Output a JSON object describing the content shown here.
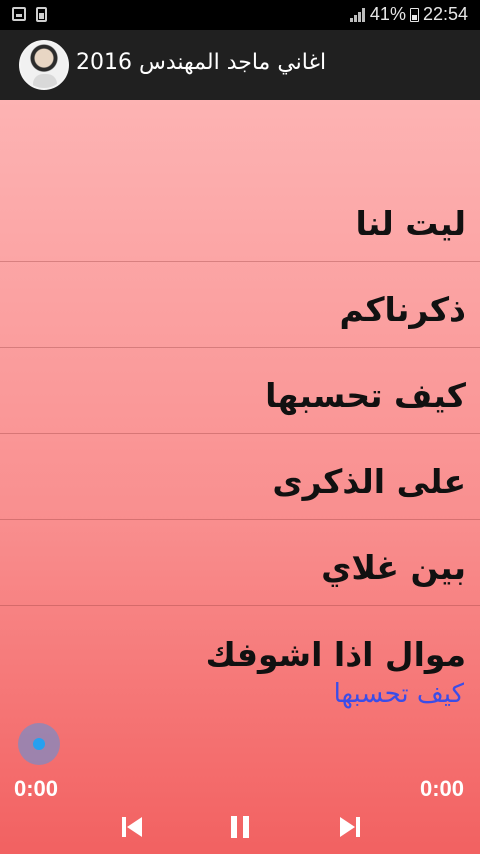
{
  "status_bar": {
    "battery_percent": "41%",
    "time": "22:54"
  },
  "app_bar": {
    "title": "اغاني ماجد المهندس 2016"
  },
  "songs": [
    {
      "label": "ليت لنا"
    },
    {
      "label": "ذكرناكم"
    },
    {
      "label": "كيف تحسبها"
    },
    {
      "label": "على الذكرى"
    },
    {
      "label": "بين غلاي"
    },
    {
      "label": "موال اذا اشوفك"
    }
  ],
  "player": {
    "now_playing": "كيف تحسبها",
    "elapsed": "0:00",
    "duration": "0:00",
    "progress_fraction": 0.0,
    "accent_color": "#27a0f0",
    "now_playing_color": "#3b4de8"
  },
  "controls": {
    "prev_icon": "skip-previous-icon",
    "pause_icon": "pause-icon",
    "next_icon": "skip-next-icon"
  }
}
